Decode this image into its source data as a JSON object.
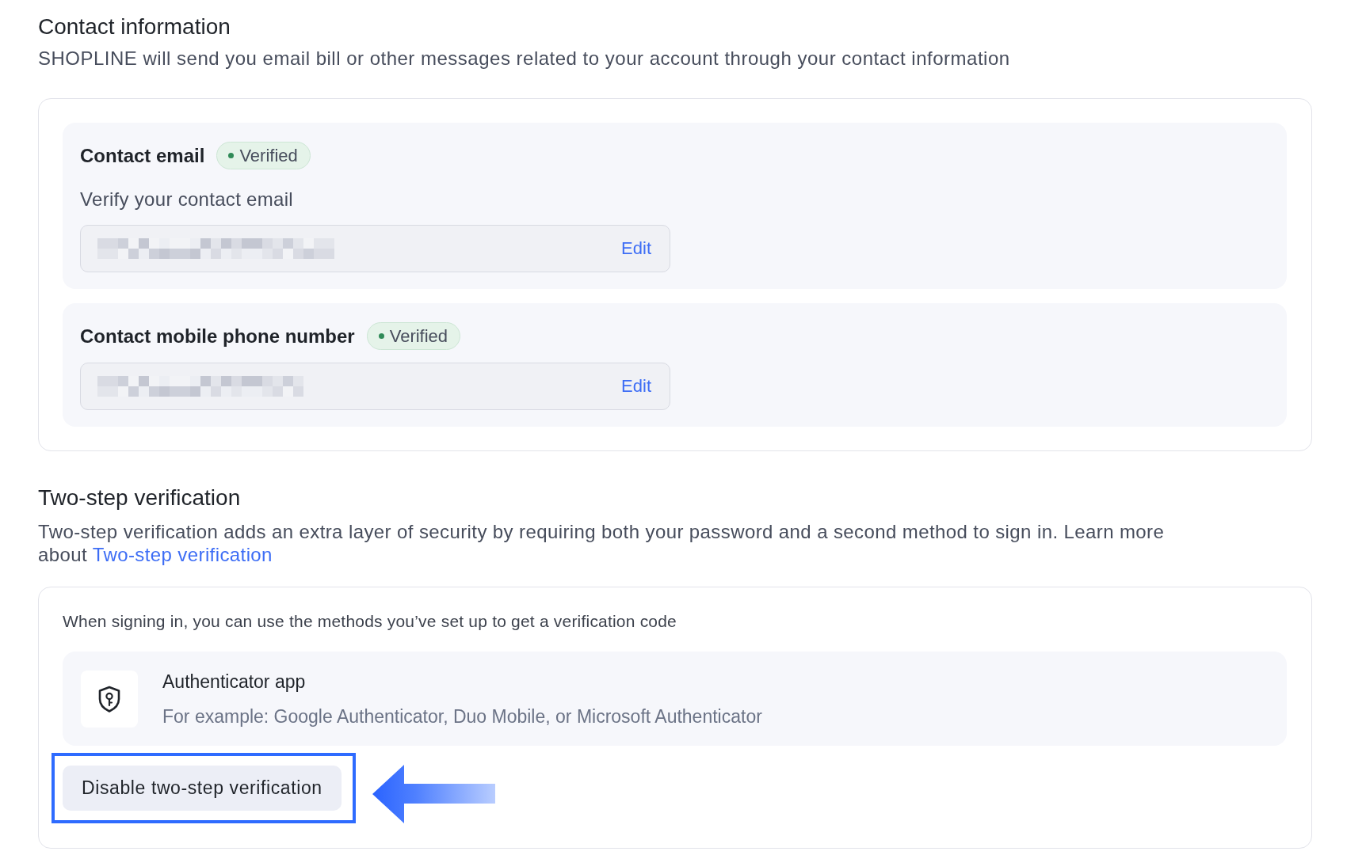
{
  "contact_information": {
    "title": "Contact information",
    "description": "SHOPLINE will send you email bill or other messages related to your account through your contact information",
    "items": [
      {
        "kind": "email",
        "title": "Contact email",
        "badge": "Verified",
        "description": "Verify your contact email",
        "field": {
          "redacted": true,
          "action": "Edit"
        }
      },
      {
        "kind": "phone",
        "title": "Contact mobile phone number",
        "badge": "Verified",
        "field": {
          "redacted": true,
          "action": "Edit"
        }
      }
    ]
  },
  "two_step_verification": {
    "title": "Two-step verification",
    "description": "Two-step verification adds an extra layer of security by requiring both your password and a second method to sign in. Learn more about",
    "link": "Two-step verification",
    "intro": "When signing in, you can use the methods you’ve set up to get a verification code",
    "methods": [
      {
        "title": "Authenticator app",
        "description": "For example: Google Authenticator, Duo Mobile, or Microsoft Authenticator"
      }
    ],
    "button": "Disable two-step verification"
  }
}
